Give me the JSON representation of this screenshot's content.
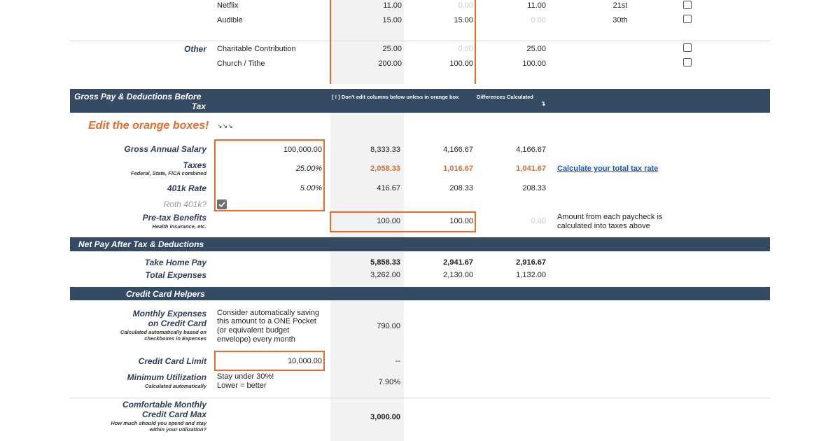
{
  "expenses": {
    "rows": [
      {
        "name": "Netflix",
        "total": "11.00",
        "p1": "0.00",
        "p2": "11.00",
        "due": "21st",
        "checked": false
      },
      {
        "name": "Audible",
        "total": "15.00",
        "p1": "15.00",
        "p2": "0.00",
        "due": "30th",
        "checked": false
      },
      {
        "name": "Charitable Contribution",
        "total": "25.00",
        "p1": "0.00",
        "p2": "25.00",
        "due": "",
        "checked": false
      },
      {
        "name": "Church / Tithe",
        "total": "200.00",
        "p1": "100.00",
        "p2": "100.00",
        "due": "",
        "checked": false
      }
    ],
    "other_label": "Other"
  },
  "gross_header": {
    "title_line1": "Gross Pay & Deductions Before",
    "title_line2": "Tax",
    "note": "[ ! ] Don't edit columns below unless in orange box",
    "diff": "Differences Calculated",
    "diff_arrow": "↴"
  },
  "edit_orange": {
    "text": "Edit the orange boxes!",
    "arrow": "↘↘↘"
  },
  "salary": {
    "label": "Gross Annual Salary",
    "input": "100,000.00",
    "monthly": "8,333.33",
    "p1": "4,166.67",
    "p2": "4,166.67"
  },
  "taxes": {
    "label": "Taxes",
    "sub": "Federal, State, FICA combined",
    "input": "25.00%",
    "monthly": "2,058.33",
    "p1": "1,016.67",
    "p2": "1,041.67",
    "link": "Calculate your total tax rate"
  },
  "k401": {
    "label": "401k Rate",
    "input": "5.00%",
    "monthly": "416.67",
    "p1": "208.33",
    "p2": "208.33"
  },
  "roth": {
    "label": "Roth 401k?",
    "checked": true
  },
  "pretax": {
    "label": "Pre-tax Benefits",
    "sub": "Health insurance, etc.",
    "monthly": "100.00",
    "p1": "100.00",
    "p2": "0.00",
    "note_line1": "Amount from each paycheck is",
    "note_line2": "calculated into taxes above"
  },
  "net_header": {
    "title": "Net Pay After Tax & Deductions"
  },
  "take_home": {
    "label": "Take Home Pay",
    "monthly": "5,858.33",
    "p1": "2,941.67",
    "p2": "2,916.67"
  },
  "total_exp": {
    "label": "Total Expenses",
    "monthly": "3,262.00",
    "p1": "2,130.00",
    "p2": "1,132.00"
  },
  "cc_header": {
    "title": "Credit Card Helpers"
  },
  "cc_monthly": {
    "label_line1": "Monthly Expenses",
    "label_line2": "on Credit Card",
    "sub_line1": "Calculated automatically based on",
    "sub_line2": "checkboxes in Expenses",
    "desc_line1": "Consider automatically saving",
    "desc_line2": "this amount to a ONE Pocket",
    "desc_line3": "(or equivalent budget",
    "desc_line4": "envelope) every month",
    "value": "790.00"
  },
  "cc_limit": {
    "label": "Credit Card Limit",
    "input": "10,000.00",
    "value": "--"
  },
  "min_util": {
    "label": "Minimum Utilization",
    "sub": "Calculated automatically",
    "desc_line1": "Stay under 30%!",
    "desc_line2": "Lower = better",
    "value": "7.90%"
  },
  "comfort": {
    "label_line1": "Comfortable Monthly",
    "label_line2": "Credit Card Max",
    "sub_line1": "How much should you spend and stay",
    "sub_line2": "within your utilization?",
    "value": "3,000.00"
  },
  "colors": {
    "navy": "#354a63",
    "orange": "#ec6a2a",
    "link": "#1155cc"
  }
}
